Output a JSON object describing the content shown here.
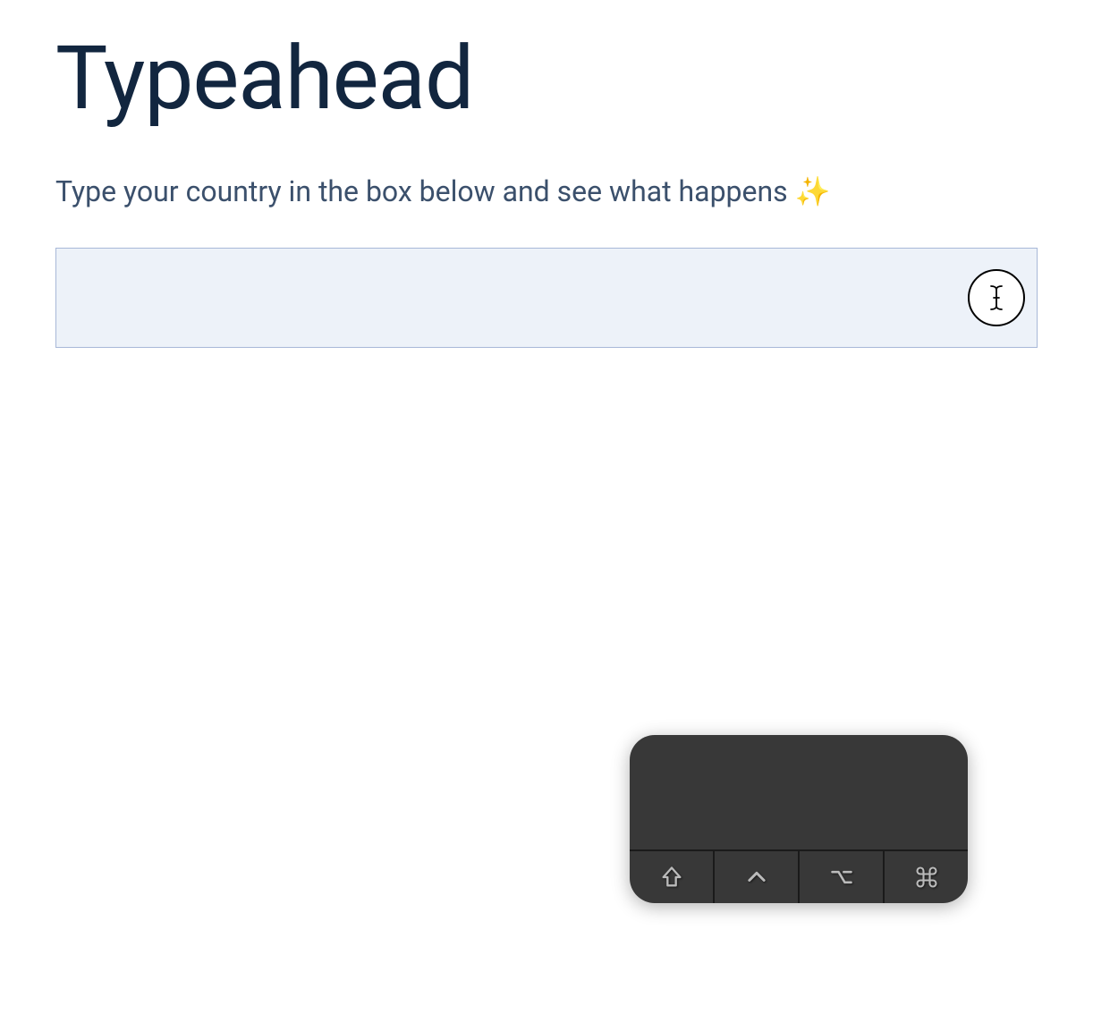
{
  "heading": "Typeahead",
  "instruction_text": "Type your country in the box below and see what happens ",
  "sparkle_emoji": "✨",
  "input": {
    "value": "",
    "placeholder": ""
  },
  "keyboard_overlay": {
    "display_text": "",
    "keys": [
      "shift",
      "control",
      "option",
      "command"
    ]
  }
}
